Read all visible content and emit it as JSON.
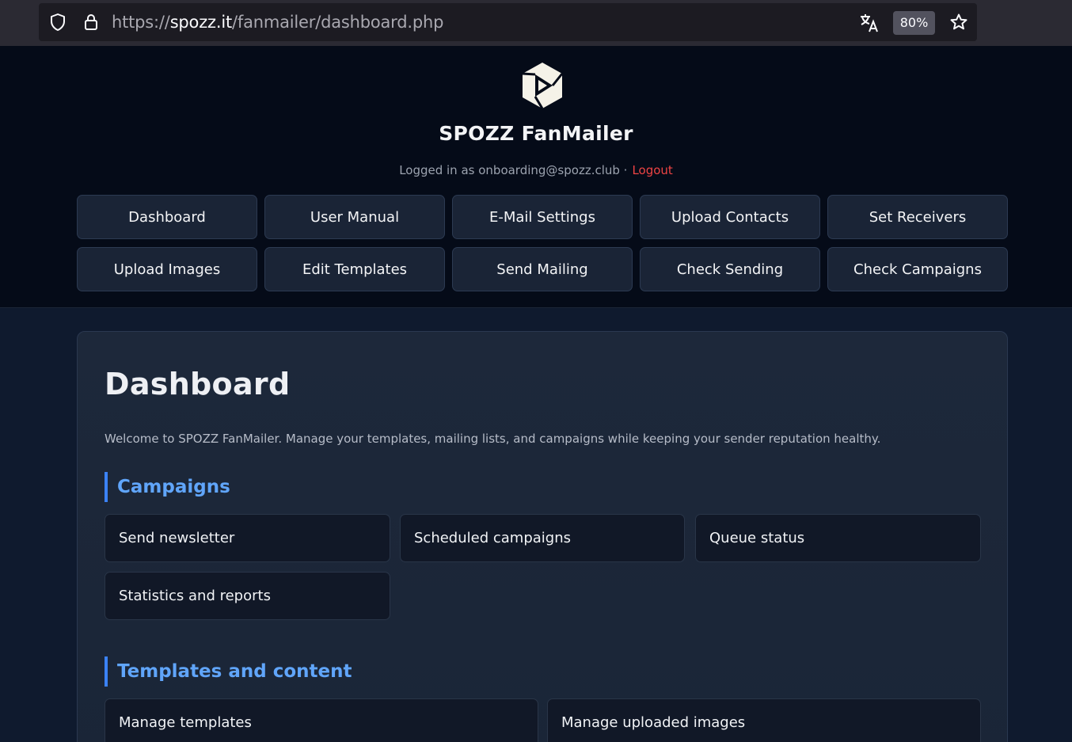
{
  "browser": {
    "url_prefix": "https://",
    "url_host": "spozz.it",
    "url_path": "/fanmailer/dashboard.php",
    "zoom": "80%",
    "icons": [
      "shield-icon",
      "lock-icon",
      "translate-icon",
      "star-icon"
    ]
  },
  "header": {
    "brand": "SPOZZ FanMailer",
    "logged_in_text": "Logged in as onboarding@spozz.club ·",
    "logout_label": "Logout"
  },
  "nav": {
    "items": [
      "Dashboard",
      "User Manual",
      "E-Mail Settings",
      "Upload Contacts",
      "Set Receivers",
      "Upload Images",
      "Edit Templates",
      "Send Mailing",
      "Check Sending",
      "Check Campaigns"
    ]
  },
  "main": {
    "title": "Dashboard",
    "intro": "Welcome to SPOZZ FanMailer. Manage your templates, mailing lists, and campaigns while keeping your sender reputation healthy.",
    "sections": [
      {
        "title": "Campaigns",
        "tiles": [
          "Send newsletter",
          "Scheduled campaigns",
          "Queue status",
          "Statistics and reports"
        ]
      },
      {
        "title": "Templates and content",
        "tiles": [
          "Manage templates",
          "Manage uploaded images"
        ]
      }
    ]
  },
  "colors": {
    "accent": "#3b82f6",
    "section_title": "#60a5fa",
    "logout": "#ef4444",
    "background": "#0b1120"
  }
}
